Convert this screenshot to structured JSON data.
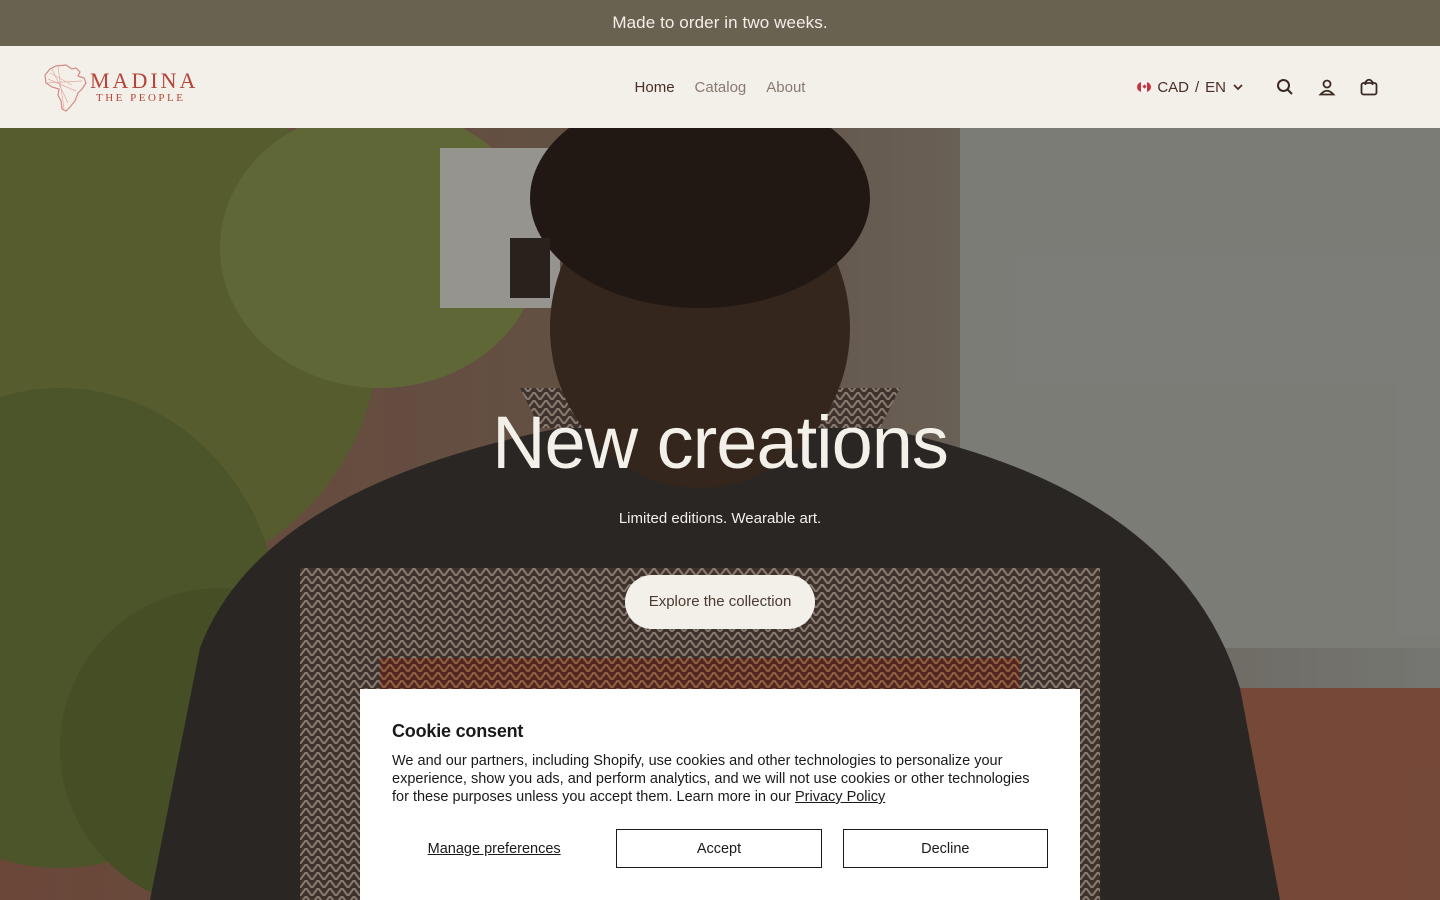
{
  "announcement": "Made to order in two weeks.",
  "header": {
    "logo_line1": "MADINA",
    "logo_line2": "THE PEOPLE",
    "nav": [
      {
        "label": "Home"
      },
      {
        "label": "Catalog"
      },
      {
        "label": "About"
      }
    ],
    "locale": {
      "currency": "CAD",
      "separator": "/",
      "language": "EN"
    }
  },
  "hero": {
    "title": "New creations",
    "subtitle": "Limited editions. Wearable art.",
    "cta": "Explore the collection"
  },
  "cookie": {
    "title": "Cookie consent",
    "body": "We and our partners, including Shopify, use cookies and other technologies to personalize your experience, show you ads, and perform analytics, and we will not use cookies or other technologies for these purposes unless you accept them. Learn more in our ",
    "link": "Privacy Policy",
    "manage": "Manage preferences",
    "accept": "Accept",
    "decline": "Decline"
  },
  "icons": [
    "africa-map-logo-icon",
    "canada-flag-icon",
    "chevron-down-icon",
    "search-icon",
    "account-icon",
    "cart-icon"
  ],
  "colors": {
    "announcement_bg": "#6a6250",
    "header_bg": "#f3efe9",
    "brand": "#b5453a",
    "nav_active": "#4a2e25",
    "nav_inactive": "#8a7a70"
  }
}
